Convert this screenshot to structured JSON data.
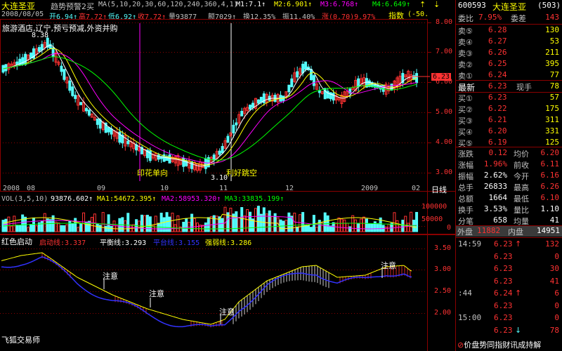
{
  "header": {
    "name": "大连圣亚",
    "indicator_name": "趋势预警2买",
    "ma_params": "MA(5,10,20,30,60,120,240,360,4,1)",
    "m1": "M1:7.1↑",
    "m2": "M2:6.901↑",
    "m3": "M3:6.768↑",
    "m4": "M4:6.649↑",
    "date": "2008/08/05",
    "open": "开6.94↑",
    "high": "高7.72↑",
    "low": "低6.92↑",
    "close": "收7.72↑",
    "volume": "量93877",
    "amount": "额7029↑",
    "turnover": "换12.35%",
    "amplitude": "振11.40%",
    "change": "涨(0.70)9.97%",
    "index_label": "指数",
    "index_value": "(-50.",
    "news": "旅游酒店,辽宁,预亏预减,外资并购"
  },
  "colors": {
    "up": "#ff3232",
    "down": "#54fcfc",
    "yellow": "#ffff00",
    "magenta": "#ff00ff",
    "green": "#00ff00",
    "grid": "#8b0000"
  },
  "price_axis": [
    "8.00",
    "7.00",
    "6.00",
    "5.00",
    "4.00",
    "3.00"
  ],
  "price_tag": "6.23",
  "date_axis": [
    "2008",
    "08",
    "09",
    "10",
    "11",
    "12",
    "2009",
    "02"
  ],
  "date_axis_label": "日线",
  "annotations": {
    "peak_high": "8.38",
    "yinhua": "印花单向",
    "lihao": "利好跳空",
    "low_price": "3.10"
  },
  "volume_panel": {
    "vol": "VOL(3,5,10)",
    "vol_value": "93876.602↑",
    "ma1": "MA1:54672.395↑",
    "ma2": "MA2:58953.320↑",
    "ma3": "MA3:33835.199↑",
    "axis": [
      "100000",
      "50000",
      "0"
    ]
  },
  "indicator_panel": {
    "name": "红色启动",
    "qidong": "启动线:3.337",
    "pingheng": "平衡线:3.293",
    "pingtai": "平台线:3.155",
    "qiangruo": "强弱线:3.286",
    "axis": [
      "3.50",
      "3.00",
      "2.50",
      "2.00"
    ],
    "note": "注意",
    "watermark": "飞狐交易师"
  },
  "right_panel": {
    "code": "600593",
    "name": "大连圣亚",
    "code_num": "(503)",
    "weibi_label": "委比",
    "weibi_value": "7.95%",
    "weicha_label": "委差",
    "weicha_value": "143",
    "asks": [
      {
        "label": "卖⑤",
        "price": "6.28",
        "vol": "130"
      },
      {
        "label": "卖④",
        "price": "6.27",
        "vol": "53"
      },
      {
        "label": "卖③",
        "price": "6.26",
        "vol": "211"
      },
      {
        "label": "卖②",
        "price": "6.25",
        "vol": "395"
      },
      {
        "label": "卖①",
        "price": "6.24",
        "vol": "77"
      }
    ],
    "latest_label": "最新",
    "latest_price": "6.23",
    "xianshou_label": "现手",
    "xianshou_value": "78",
    "bids": [
      {
        "label": "买①",
        "price": "6.23",
        "vol": "57"
      },
      {
        "label": "买②",
        "price": "6.22",
        "vol": "175"
      },
      {
        "label": "买③",
        "price": "6.21",
        "vol": "311"
      },
      {
        "label": "买④",
        "price": "6.20",
        "vol": "331"
      },
      {
        "label": "买⑤",
        "price": "6.19",
        "vol": "125"
      }
    ],
    "stats": [
      {
        "l1": "涨跌",
        "v1": "0.12",
        "l2": "均价",
        "v2": "6.20"
      },
      {
        "l1": "涨幅",
        "v1": "1.96%",
        "l2": "前收",
        "v2": "6.11"
      },
      {
        "l1": "振幅",
        "v1": "2.62%",
        "l2": "今开",
        "v2": "6.16"
      },
      {
        "l1": "总手",
        "v1": "26833",
        "l2": "最高",
        "v2": "6.26"
      },
      {
        "l1": "总额",
        "v1": "1664",
        "l2": "最低",
        "v2": "6.10"
      },
      {
        "l1": "换手",
        "v1": "3.53%",
        "l2": "量比",
        "v2": "1.10"
      },
      {
        "l1": "分笔",
        "v1": "658",
        "l2": "均量",
        "v2": "41"
      }
    ],
    "waipan_label": "外盘",
    "waipan_value": "11882",
    "neipan_label": "内盘",
    "neipan_value": "14951",
    "ticks": [
      {
        "time": "14:59",
        "price": "6.23",
        "vol": "132",
        "arrow": "↑"
      },
      {
        "time": "",
        "price": "6.23",
        "vol": "0",
        "arrow": ""
      },
      {
        "time": "",
        "price": "6.23",
        "vol": "30",
        "arrow": ""
      },
      {
        "time": "",
        "price": "6.23",
        "vol": "41",
        "arrow": ""
      },
      {
        "time": ":44",
        "price": "6.24",
        "vol": "6",
        "arrow": "↑"
      },
      {
        "time": "",
        "price": "6.23",
        "vol": "0",
        "arrow": ""
      },
      {
        "time": "15:00",
        "price": "6.23",
        "vol": "0",
        "arrow": ""
      },
      {
        "time": "",
        "price": "6.23",
        "vol": "78",
        "arrow": "↓"
      }
    ],
    "footer": "价盘势同指财讯成持解"
  }
}
